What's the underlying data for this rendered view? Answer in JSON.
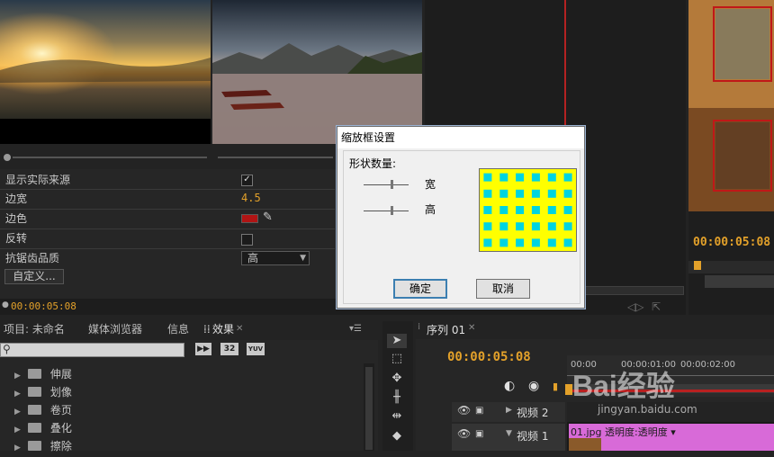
{
  "fx": {
    "show_actual_source": "显示实际来源",
    "border_width_label": "边宽",
    "border_width_value": "4.5",
    "border_color_label": "边色",
    "invert_label": "反转",
    "aa_label": "抗锯齿品质",
    "aa_value": "高",
    "custom_button": "自定义...",
    "timecode": "00:00:05:08"
  },
  "dialog": {
    "title": "缩放框设置",
    "shape_count_label": "形状数量:",
    "width_label": "宽",
    "height_label": "高",
    "ok": "确定",
    "cancel": "取消"
  },
  "bottom_tabs": {
    "project": "项目: 未命名",
    "media_browser": "媒体浏览器",
    "info": "信息",
    "effects": "效果"
  },
  "effects_list": {
    "badge_32": "32",
    "badge_yuv": "YUV",
    "items": [
      "伸展",
      "划像",
      "卷页",
      "叠化",
      "擦除"
    ]
  },
  "sequence": {
    "tab": "序列 01",
    "timecode": "00:00:05:08",
    "ruler": [
      "00:00",
      "00:00:01:00",
      "00:00:02:00"
    ],
    "track_video2": "视频 2",
    "track_video1": "视频 1",
    "clip_label": "01.jpg  透明度:透明度 ▾"
  },
  "right_monitor": {
    "timecode": "00:00:05:08"
  },
  "watermark": {
    "text": "Bai经验",
    "url": "jingyan.baidu.com"
  },
  "colors": {
    "accent_orange": "#e3a12a",
    "border_color_swatch": "#b01414",
    "grid_yellow": "#ffff00",
    "grid_cyan": "#00d4e0",
    "clip_pink": "#d86ad8"
  }
}
